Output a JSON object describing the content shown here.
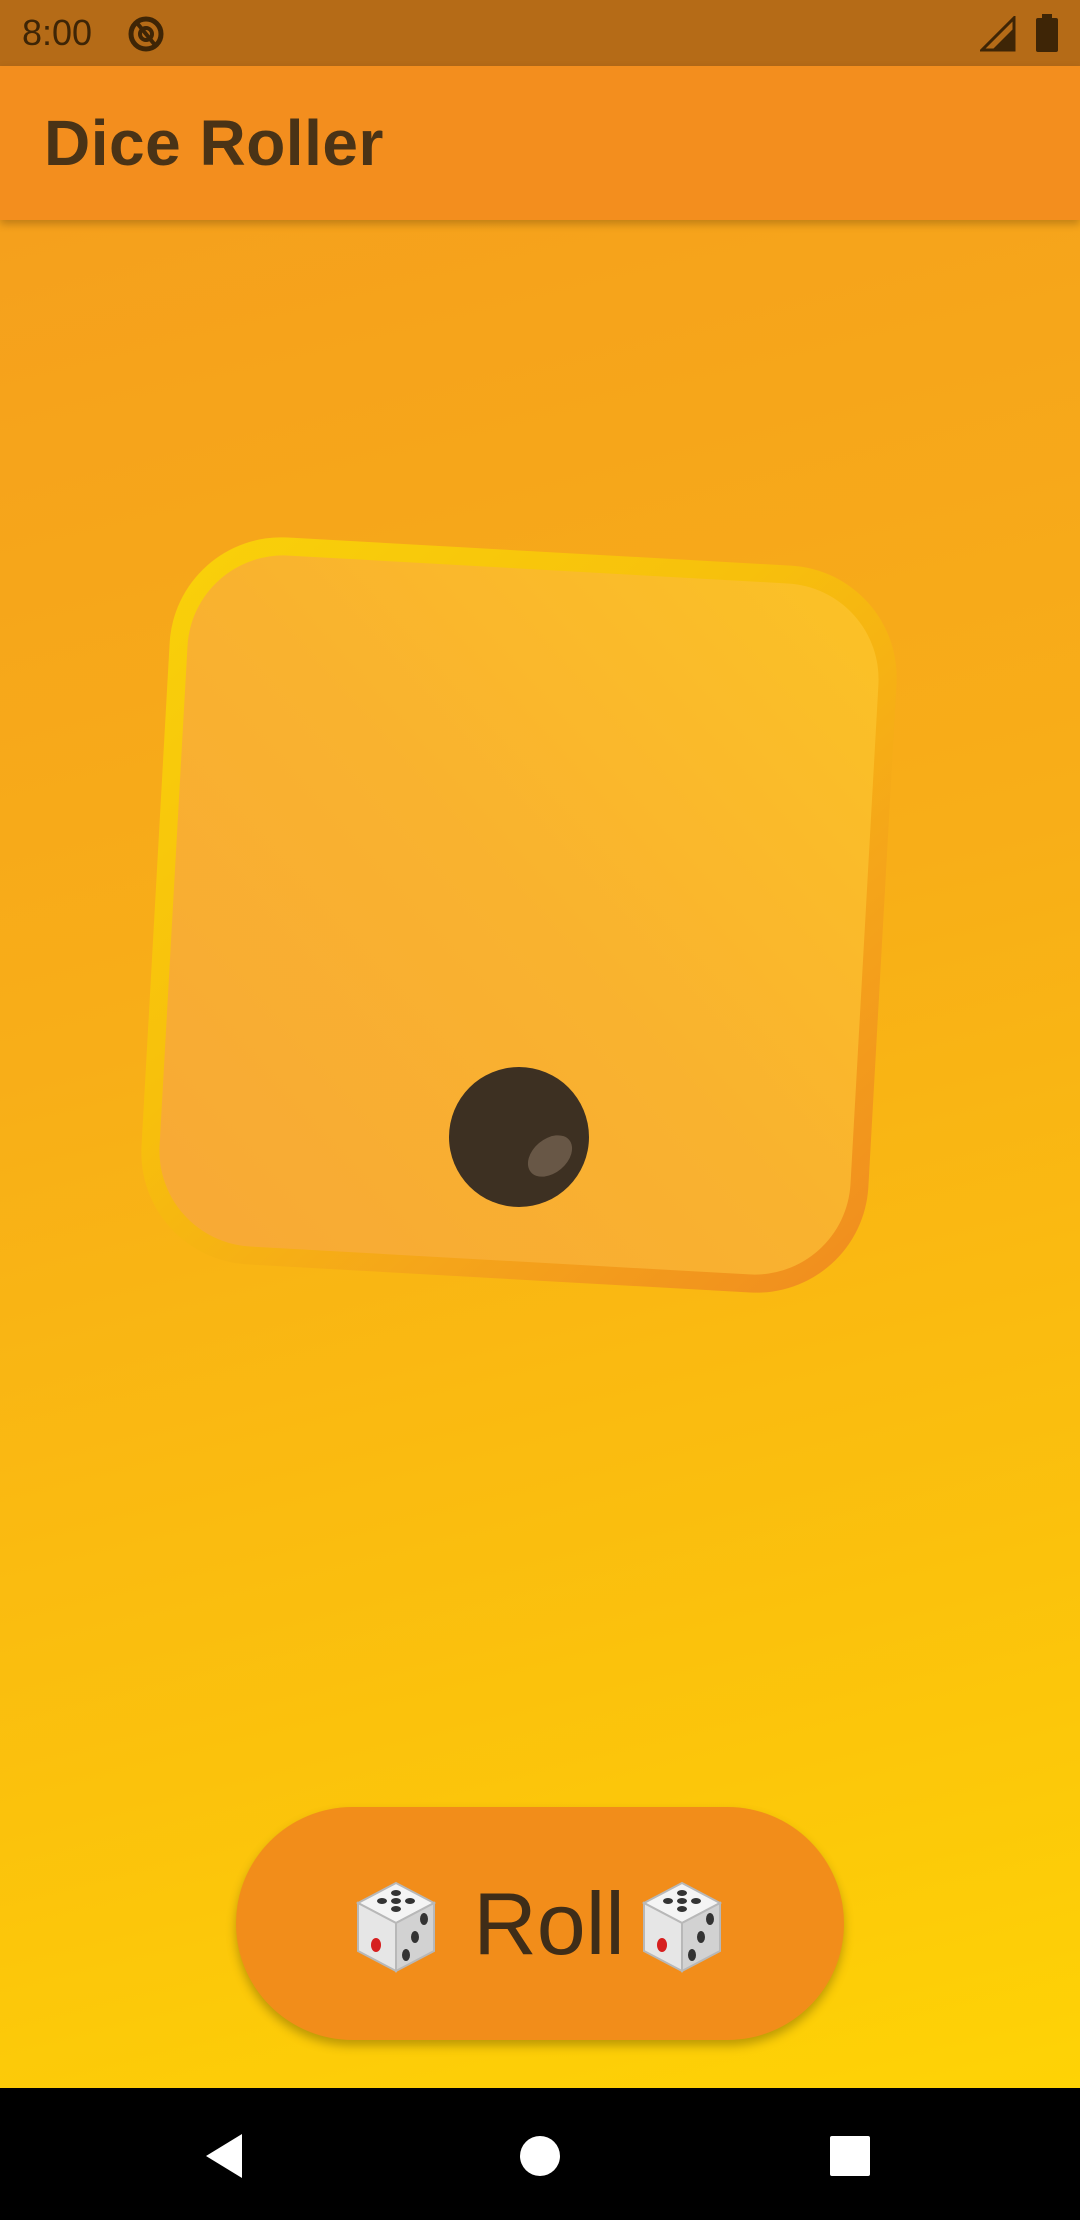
{
  "status_bar": {
    "time": "8:00",
    "icons": [
      "at-sign-icon",
      "cell-signal-icon",
      "battery-icon"
    ]
  },
  "app_bar": {
    "title": "Dice Roller"
  },
  "die": {
    "value": 1
  },
  "roll_button": {
    "label": "Roll",
    "icons": [
      "dice-icon",
      "dice-icon"
    ]
  },
  "nav_bar": {
    "icons": [
      "back-icon",
      "home-icon",
      "recents-icon"
    ]
  },
  "colors": {
    "app_bar": "#f38e1e",
    "status_bar": "#b56b17",
    "button": "#f28d1a",
    "text": "#4a3316",
    "pip": "#3d3022"
  }
}
